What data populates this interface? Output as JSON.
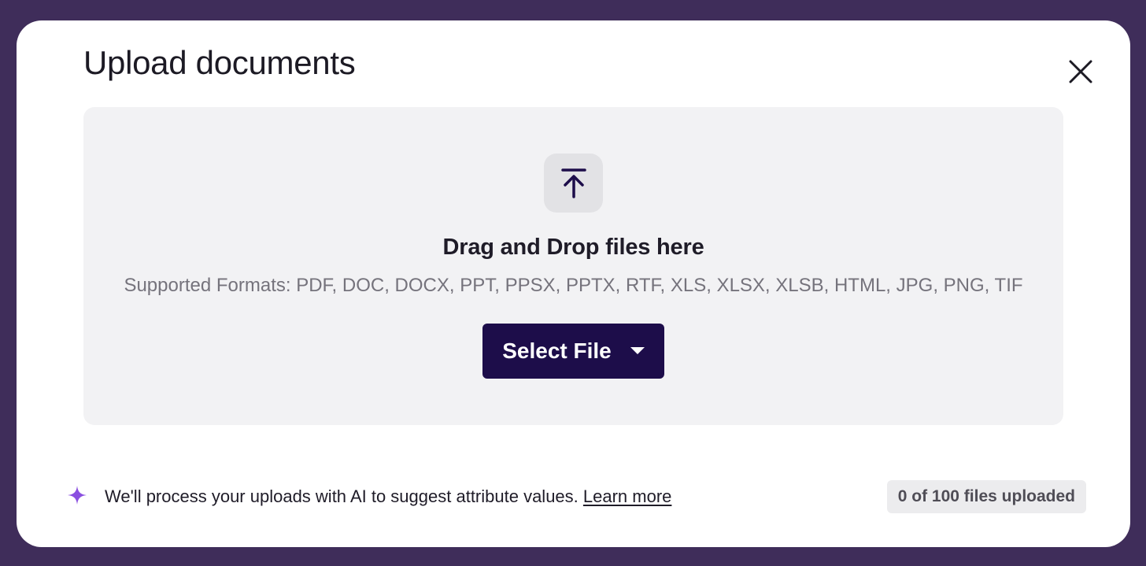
{
  "dialog": {
    "title": "Upload documents",
    "close_icon": "close-icon"
  },
  "dropzone": {
    "icon": "upload-icon",
    "heading": "Drag and Drop files here",
    "formats": "Supported Formats: PDF, DOC, DOCX, PPT, PPSX, PPTX, RTF, XLS, XLSX, XLSB, HTML, JPG, PNG, TIF",
    "select_button_label": "Select File",
    "select_button_icon": "caret-down-icon"
  },
  "footer": {
    "sparkle_icon": "sparkle-icon",
    "ai_notice": "We'll process your uploads with AI to suggest attribute values.",
    "learn_more": "Learn more",
    "upload_counter": "0 of 100 files uploaded"
  },
  "colors": {
    "backdrop": "#3f2d5a",
    "primary_button": "#1d0d4a",
    "sparkle": "#8a4fe0",
    "dropzone_bg": "#f2f2f4"
  }
}
